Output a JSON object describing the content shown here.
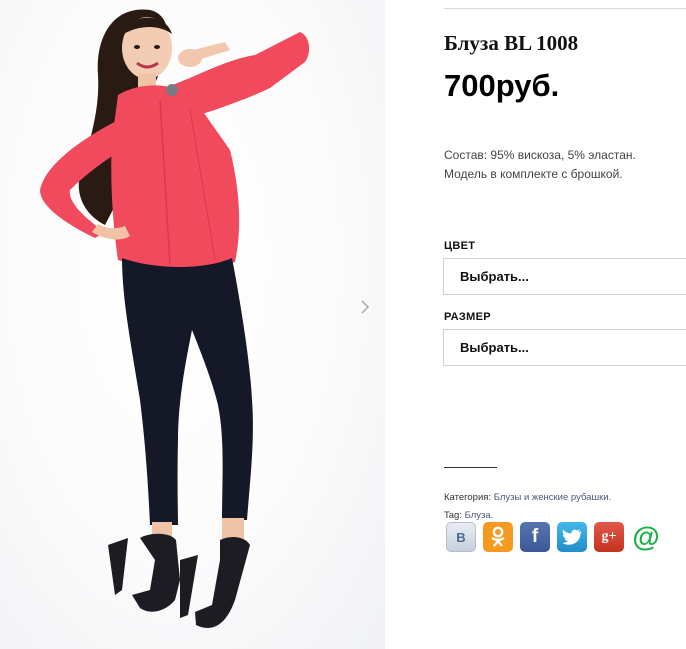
{
  "product": {
    "title": "Блуза BL 1008",
    "price": "700руб.",
    "description": [
      "Состав: 95% вискоза, 5% эластан.",
      "Модель в комплекте с брошкой."
    ]
  },
  "options": {
    "color": {
      "label": "ЦВЕТ",
      "value": "Выбрать..."
    },
    "size": {
      "label": "РАЗМЕР",
      "value": "Выбрать..."
    }
  },
  "meta": {
    "category_label": "Категория:",
    "category_value": "Блузы и женские рубашки.",
    "tag_label": "Tag:",
    "tag_value": "Блуза."
  },
  "share": [
    {
      "icon": "vkontakte-icon",
      "glyph": "В",
      "color": "#ffffff"
    },
    {
      "icon": "odnoklassniki-icon",
      "glyph": "ok",
      "color": "#f59a1f"
    },
    {
      "icon": "facebook-icon",
      "glyph": "f",
      "color": "#3b5998"
    },
    {
      "icon": "twitter-icon",
      "glyph": "t",
      "color": "#2ca6de"
    },
    {
      "icon": "google-plus-icon",
      "glyph": "g+",
      "color": "#d34836"
    },
    {
      "icon": "mailru-icon",
      "glyph": "@",
      "color": "#1bb24a"
    }
  ],
  "colors": {
    "blouse": "#f04a5c",
    "pants": "#151826"
  }
}
